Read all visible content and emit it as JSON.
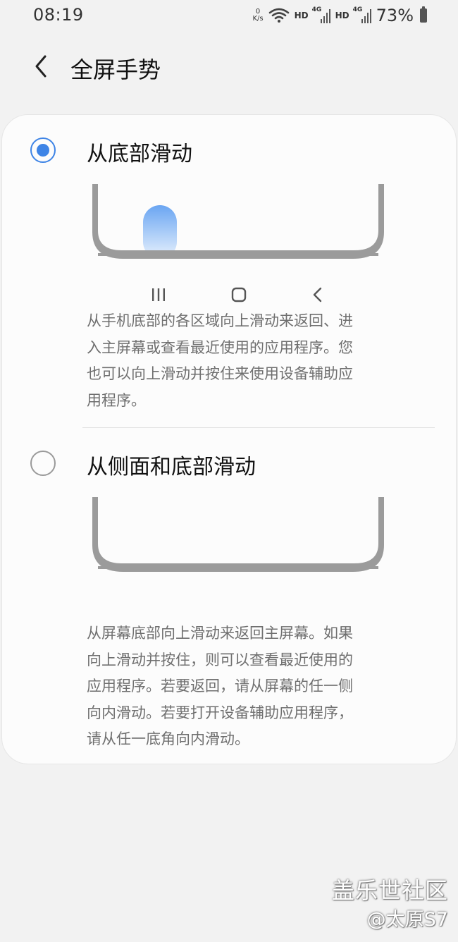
{
  "status": {
    "time": "08:19",
    "net_speed_value": "0",
    "net_speed_unit": "K/s",
    "hd1": "HD",
    "sig1_tag": "4G",
    "hd2": "HD",
    "sig2_tag": "4G",
    "battery": "73%"
  },
  "header": {
    "title": "全屏手势",
    "back_icon": "chevron-left-icon"
  },
  "options": [
    {
      "label": "从底部滑动",
      "selected": true,
      "description_lines": [
        "从手机底部的各区域向上滑动来返回、进",
        "入主屏幕或查看最近使用的应用程序。您",
        "也可以向上滑动并按住来使用设备辅助应",
        "用程序。"
      ]
    },
    {
      "label": "从侧面和底部滑动",
      "selected": false,
      "description_lines": [
        "从屏幕底部向上滑动来返回主屏幕。如果",
        "向上滑动并按住，则可以查看最近使用的",
        "应用程序。若要返回，请从屏幕的任一侧",
        "向内滑动。若要打开设备辅助应用程序，",
        "请从任一底角向内滑动。"
      ]
    }
  ],
  "nav_icons": [
    "recents-icon",
    "home-icon",
    "back-icon"
  ],
  "colors": {
    "accent": "#3e84e6",
    "gesture_gradient_top": "#6aa5f2",
    "gesture_gradient_bottom": "#e8f1fd"
  },
  "watermark": {
    "line1": "盖乐世社区",
    "line2": "@太原S7"
  }
}
